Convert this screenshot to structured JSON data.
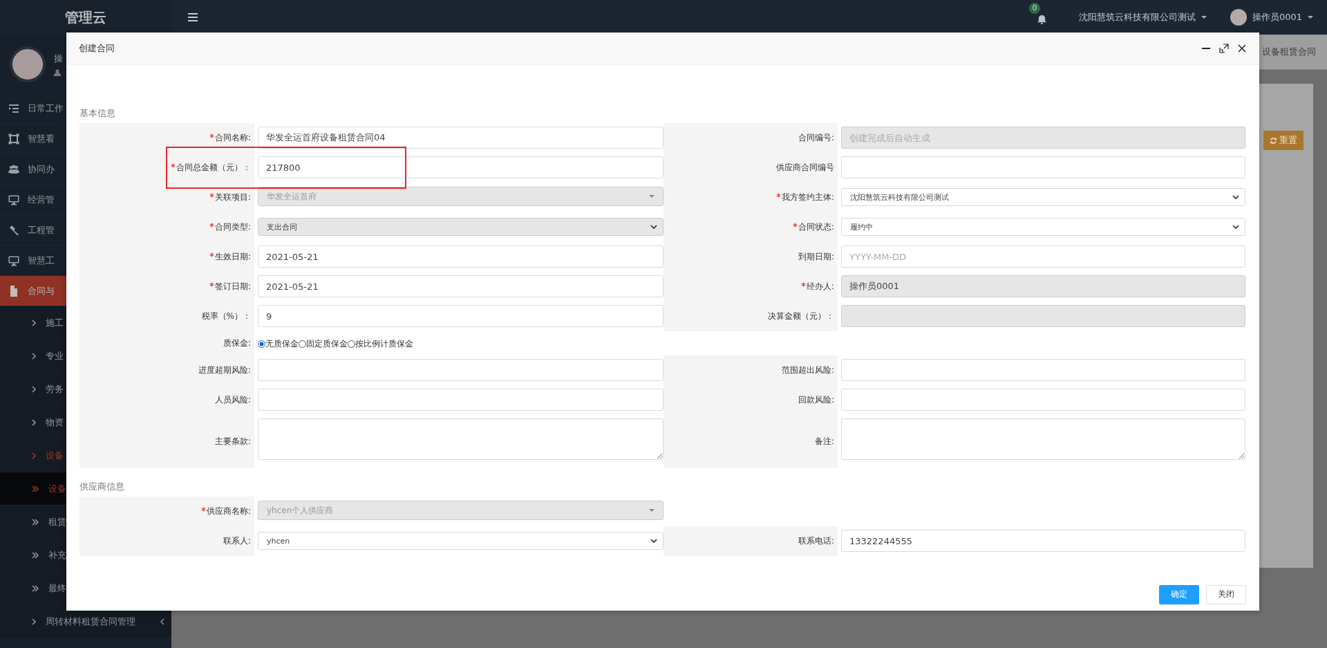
{
  "sidebar": {
    "logo": "管理云",
    "user_name": "操",
    "menu": [
      {
        "label": "日常工作",
        "selected": false
      },
      {
        "label": "智慧看",
        "selected": false
      },
      {
        "label": "协同办",
        "selected": false
      },
      {
        "label": "经营管",
        "selected": false
      },
      {
        "label": "工程管",
        "selected": false
      },
      {
        "label": "智慧工",
        "selected": false
      },
      {
        "label": "合同与",
        "selected": true
      }
    ],
    "submenu": [
      {
        "label": "施工",
        "kind": "group",
        "active": false,
        "selected": false
      },
      {
        "label": "专业",
        "kind": "group",
        "active": false,
        "selected": false
      },
      {
        "label": "劳务",
        "kind": "group",
        "active": false,
        "selected": false
      },
      {
        "label": "物资",
        "kind": "group",
        "active": false,
        "selected": false
      },
      {
        "label": "设备",
        "kind": "group",
        "active": true,
        "selected": false
      },
      {
        "label": "设备",
        "kind": "page",
        "active": true,
        "selected": true
      },
      {
        "label": "租赁",
        "kind": "page",
        "active": false,
        "selected": false
      },
      {
        "label": "补充",
        "kind": "page",
        "active": false,
        "selected": false
      },
      {
        "label": "最终",
        "kind": "page",
        "active": false,
        "selected": false
      },
      {
        "label": "周转材料租赁合同管理",
        "kind": "group",
        "active": false,
        "selected": false,
        "expandable": true
      }
    ]
  },
  "topbar": {
    "notification_count": "0",
    "company": "沈阳慧筑云科技有限公司测试",
    "user": "操作员0001"
  },
  "background": {
    "tab": "设备租赁合同",
    "reset_button": "重置"
  },
  "dialog": {
    "title": "创建合同",
    "sections": [
      {
        "title": "基本信息",
        "rows": [
          {
            "left": {
              "label": "合同名称:",
              "required": true,
              "kind": "input",
              "value": "华发全运首府设备租赁合同04",
              "disabled": false
            },
            "right": {
              "label": "合同编号:",
              "required": false,
              "kind": "input",
              "placeholder": "创建完成后自动生成",
              "disabled": true
            }
          },
          {
            "left": {
              "label": "合同总金额（元）：",
              "required": true,
              "kind": "input",
              "value": "217800",
              "disabled": false,
              "highlighted": true
            },
            "right": {
              "label": "供应商合同编号",
              "required": false,
              "kind": "input",
              "disabled": false
            }
          },
          {
            "left": {
              "label": "关联项目:",
              "required": true,
              "kind": "dropdown",
              "value": "华发全运首府",
              "disabled": true
            },
            "right": {
              "label": "我方签约主体:",
              "required": true,
              "kind": "select",
              "value": "沈阳慧筑云科技有限公司测试",
              "disabled": false
            }
          },
          {
            "left": {
              "label": "合同类型:",
              "required": true,
              "kind": "select",
              "value": "支出合同",
              "disabled": true
            },
            "right": {
              "label": "合同状态:",
              "required": true,
              "kind": "select",
              "value": "履约中",
              "disabled": false
            }
          },
          {
            "left": {
              "label": "生效日期:",
              "required": true,
              "kind": "input",
              "value": "2021-05-21",
              "disabled": false
            },
            "right": {
              "label": "到期日期:",
              "required": false,
              "kind": "input",
              "placeholder": "YYYY-MM-DD",
              "disabled": false
            }
          },
          {
            "left": {
              "label": "签订日期:",
              "required": true,
              "kind": "input",
              "value": "2021-05-21",
              "disabled": false
            },
            "right": {
              "label": "经办人:",
              "required": true,
              "kind": "input",
              "value": "操作员0001",
              "disabled": true
            }
          },
          {
            "left": {
              "label": "税率（%）：",
              "required": false,
              "kind": "input",
              "value": "9",
              "disabled": false
            },
            "right": {
              "label": "决算金额（元）：",
              "required": false,
              "kind": "input",
              "disabled": true
            }
          },
          {
            "left": {
              "label": "质保金:",
              "required": false,
              "kind": "radio",
              "options": [
                {
                  "label": "无质保金",
                  "selected": true
                },
                {
                  "label": "固定质保金",
                  "selected": false
                },
                {
                  "label": "按比例计质保金",
                  "selected": false
                }
              ]
            }
          },
          {
            "left": {
              "label": "进度超期风险:",
              "required": false,
              "kind": "input",
              "disabled": false
            },
            "right": {
              "label": "范围超出风险:",
              "required": false,
              "kind": "input",
              "disabled": false
            }
          },
          {
            "left": {
              "label": "人员风险:",
              "required": false,
              "kind": "input",
              "disabled": false
            },
            "right": {
              "label": "回款风险:",
              "required": false,
              "kind": "input",
              "disabled": false
            }
          },
          {
            "left": {
              "label": "主要条款:",
              "required": false,
              "kind": "textarea",
              "disabled": false
            },
            "right": {
              "label": "备注:",
              "required": false,
              "kind": "textarea",
              "disabled": false
            }
          }
        ]
      },
      {
        "title": "供应商信息",
        "rows": [
          {
            "left": {
              "label": "供应商名称:",
              "required": true,
              "kind": "dropdown",
              "value": "yhcen个人供应商",
              "disabled": true
            }
          },
          {
            "left": {
              "label": "联系人:",
              "required": false,
              "kind": "select",
              "value": "yhcen",
              "disabled": false
            },
            "right": {
              "label": "联系电话:",
              "required": false,
              "kind": "input",
              "value": "13322244555",
              "disabled": false
            }
          }
        ]
      }
    ],
    "buttons": [
      {
        "label": "确定",
        "kind": "primary"
      },
      {
        "label": "关闭",
        "kind": "default"
      }
    ]
  }
}
